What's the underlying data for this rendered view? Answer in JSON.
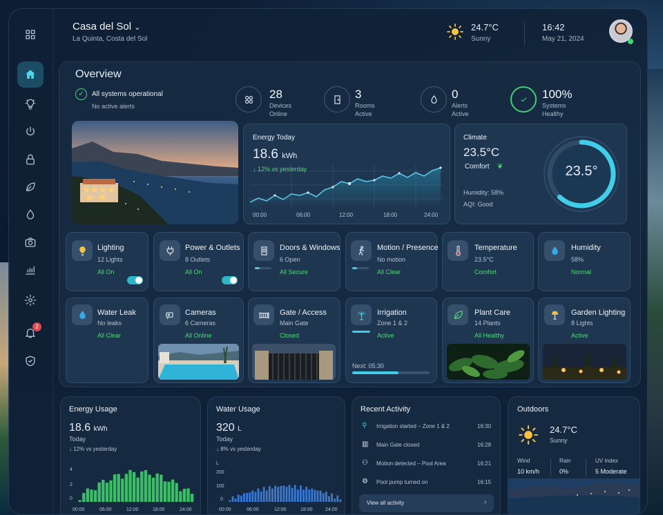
{
  "header": {
    "title": "Casa del Sol",
    "location": "La Quinta, Costa del Sol",
    "temp": "24.7°C",
    "condition": "Sunny",
    "time": "16:42",
    "date": "May 21, 2024"
  },
  "sidebar": {
    "items": [
      "grid-icon",
      "home-icon",
      "bulb-icon",
      "power-icon",
      "lock-icon",
      "leaf-icon",
      "drop-icon",
      "camera-icon",
      "chart-icon",
      "gear-icon",
      "bell-icon",
      "shield-icon"
    ],
    "notification_count": "2"
  },
  "overview": {
    "title": "Overview",
    "status": "All systems operational",
    "status_sub": "No active alerts",
    "stats": [
      {
        "value": "28",
        "label1": "Devices",
        "label2": "Online"
      },
      {
        "value": "3",
        "label1": "Rooms",
        "label2": "Active"
      },
      {
        "value": "0",
        "label1": "Alerts",
        "label2": "Active"
      },
      {
        "value": "100%",
        "label1": "Systems",
        "label2": "Healthy"
      }
    ]
  },
  "energy_today": {
    "title": "Energy Today",
    "value": "18.6",
    "unit": "kWh",
    "change": "↓ 12% vs yesterday",
    "ticks": [
      "00:00",
      "06:00",
      "12:00",
      "18:00",
      "24:00"
    ]
  },
  "climate": {
    "title": "Climate",
    "temp": "23.5°C",
    "status": "Comfort",
    "humidity": "Humidity: 58%",
    "aqi": "AQI: Good",
    "gauge": "23.5°",
    "gauge_level": 0.62
  },
  "devices": [
    {
      "title": "Lighting",
      "sub": "12 Lights",
      "status": "All On"
    },
    {
      "title": "Power & Outlets",
      "sub": "8 Outlets",
      "status": "All On"
    },
    {
      "title": "Doors & Windows",
      "sub": "6 Open",
      "status": "All Secure"
    },
    {
      "title": "Motion / Presence",
      "sub": "No motion",
      "status": "All Clear"
    },
    {
      "title": "Temperature",
      "sub": "23.5°C",
      "status": "Comfort"
    },
    {
      "title": "Humidity",
      "sub": "58%",
      "status": "Normal"
    },
    {
      "title": "Water Leak",
      "sub": "No leaks",
      "status": "All Clear"
    },
    {
      "title": "Cameras",
      "sub": "6 Cameras",
      "status": "All Online"
    },
    {
      "title": "Gate / Access",
      "sub": "Main Gate",
      "status": "Closed"
    },
    {
      "title": "Irrigation",
      "sub": "Zone 1 & 2",
      "status": "Active",
      "next": "Next: 05:30"
    },
    {
      "title": "Plant Care",
      "sub": "14 Plants",
      "status": "All Healthy"
    },
    {
      "title": "Garden Lighting",
      "sub": "8 Lights",
      "status": "Active"
    }
  ],
  "energy_usage": {
    "title": "Energy Usage",
    "value": "18.6",
    "unit": "kWh",
    "period": "Today",
    "change": "↓ 12% vs yesterday",
    "yticks": [
      "4",
      "2",
      "0"
    ],
    "xticks": [
      "00:00",
      "06:00",
      "12:00",
      "18:00",
      "24:00"
    ]
  },
  "water_usage": {
    "title": "Water Usage",
    "value": "320",
    "unit": "L",
    "period": "Today",
    "change": "↓ 8% vs yesterday",
    "yunit": "L",
    "yticks": [
      "200",
      "100",
      "0"
    ],
    "xticks": [
      "00:00",
      "06:00",
      "12:00",
      "18:00",
      "24:00"
    ]
  },
  "activity": {
    "title": "Recent Activity",
    "items": [
      {
        "text": "Irrigation started – Zone 1 & 2",
        "time": "16:30"
      },
      {
        "text": "Main Gate closed",
        "time": "16:28"
      },
      {
        "text": "Motion detected – Pool Area",
        "time": "16:21"
      },
      {
        "text": "Pool pump turned on",
        "time": "16:15"
      }
    ],
    "link": "View all activity"
  },
  "outdoors": {
    "title": "Outdoors",
    "temp": "24.7°C",
    "condition": "Sunny",
    "wind_label": "Wind",
    "wind": "10 km/h",
    "rain_label": "Rain",
    "rain": "0%",
    "uv_label": "UV Index",
    "uv": "5 Moderate"
  },
  "colors": {
    "accent": "#4fd8ef",
    "green": "#53d879",
    "energy_bar": "#3ecf6a",
    "water_bar": "#3d7fe0"
  }
}
